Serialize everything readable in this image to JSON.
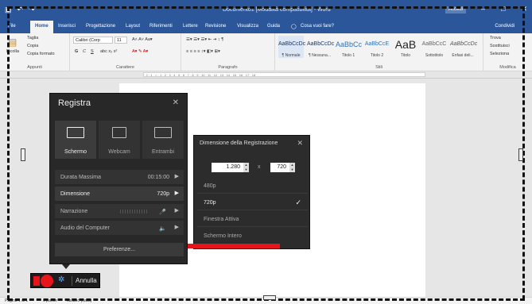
{
  "word": {
    "doc_title": "Documento1 [Modalità compatibilità] - Word",
    "user_badge": "Accedi",
    "tabs": [
      "File",
      "Home",
      "Inserisci",
      "Progettazione",
      "Layout",
      "Riferimenti",
      "Lettere",
      "Revisione",
      "Visualizza",
      "Guida"
    ],
    "tell_me": "Cosa vuoi fare?",
    "share": "Condividi",
    "clipboard": {
      "paste": "Incolla",
      "cut": "Taglia",
      "copy": "Copia",
      "format_painter": "Copia formato",
      "label": "Appunti"
    },
    "font": {
      "name": "Calibri (Corp",
      "size": "11",
      "bold": "G",
      "italic": "C",
      "underline": "S",
      "label": "Carattere"
    },
    "paragraph": {
      "label": "Paragrafo"
    },
    "styles": {
      "label": "Stili",
      "items": [
        {
          "preview": "AaBbCcDc",
          "name": "¶ Normale"
        },
        {
          "preview": "AaBbCcDc",
          "name": "¶ Nessuna..."
        },
        {
          "preview": "AaBbCc",
          "name": "Titolo 1"
        },
        {
          "preview": "AaBbCcE",
          "name": "Titolo 2"
        },
        {
          "preview": "AaB",
          "name": "Titolo"
        },
        {
          "preview": "AaBbCcC",
          "name": "Sottotitolo"
        },
        {
          "preview": "AaBbCcDc",
          "name": "Enfasi deli..."
        }
      ]
    },
    "editing": {
      "find": "Trova",
      "replace": "Sostituisci",
      "select": "Seleziona",
      "label": "Modifica"
    },
    "ruler": "· 2 · 1 · ⌂ · 1 · 2 · 3 · 4 · 5 · 6 · 7 · 8 · 9 · 10 · 11 · 12 · 13 · 14 · 15 · 16 · 17 · 18 ·",
    "status": {
      "page": "Pagina 1 di 1",
      "words": "0 parole",
      "language": "Italiano (Italia)"
    }
  },
  "recorder": {
    "title": "Registra",
    "modes": [
      {
        "label": "Schermo",
        "icon": "monitor-icon"
      },
      {
        "label": "Webcam",
        "icon": "webcam-icon"
      },
      {
        "label": "Entrambi",
        "icon": "screen-and-webcam-icon"
      }
    ],
    "rows": [
      {
        "key": "Durata Massima",
        "value": "00:15:00"
      },
      {
        "key": "Dimensione",
        "value": "720p"
      },
      {
        "key": "Narrazione",
        "value": ""
      },
      {
        "key": "Audio del Computer",
        "value": ""
      }
    ],
    "preferences": "Preferenze...",
    "cancel": "Annulla"
  },
  "size_panel": {
    "title": "Dimensione della Registrazione",
    "width": "1.280",
    "height": "720",
    "times": "x",
    "options": [
      {
        "label": "480p",
        "selected": false
      },
      {
        "label": "720p",
        "selected": true
      },
      {
        "label": "Finestra Attiva",
        "selected": false
      },
      {
        "label": "Schermo Intero",
        "selected": false
      }
    ]
  },
  "colors": {
    "word_blue": "#2b579a",
    "record_red": "#e8141b",
    "dialog_bg": "#282828",
    "highlight": "#e8141b"
  }
}
